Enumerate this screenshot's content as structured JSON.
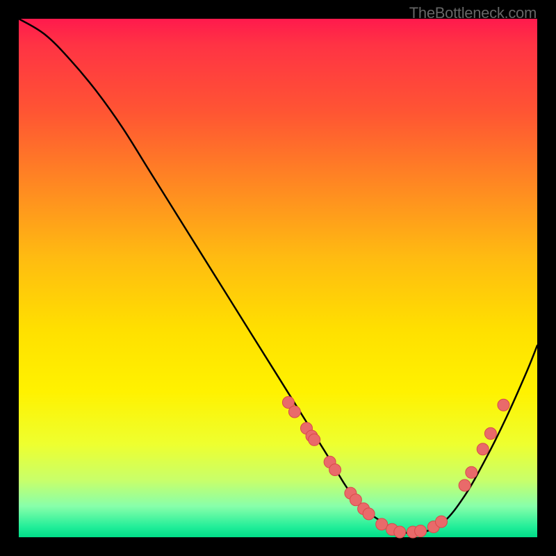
{
  "watermark": "TheBottleneck.com",
  "chart_data": {
    "type": "line",
    "title": "",
    "xlabel": "",
    "ylabel": "",
    "xlim": [
      0,
      100
    ],
    "ylim": [
      0,
      100
    ],
    "curve": {
      "x": [
        0,
        5,
        10,
        15,
        20,
        25,
        30,
        35,
        40,
        45,
        50,
        55,
        60,
        63,
        66,
        70,
        74,
        78,
        82,
        86,
        90,
        94,
        98,
        100
      ],
      "y": [
        100,
        97,
        92,
        86,
        79,
        71,
        63,
        55,
        47,
        39,
        31,
        23,
        15,
        10,
        6,
        3,
        1,
        1,
        3,
        8,
        15,
        23,
        32,
        37
      ]
    },
    "markers": [
      {
        "x": 52.0,
        "y": 26.0
      },
      {
        "x": 53.2,
        "y": 24.2
      },
      {
        "x": 55.5,
        "y": 21.0
      },
      {
        "x": 56.5,
        "y": 19.5
      },
      {
        "x": 57.0,
        "y": 18.8
      },
      {
        "x": 60.0,
        "y": 14.5
      },
      {
        "x": 61.0,
        "y": 13.0
      },
      {
        "x": 64.0,
        "y": 8.5
      },
      {
        "x": 65.0,
        "y": 7.2
      },
      {
        "x": 66.5,
        "y": 5.5
      },
      {
        "x": 67.5,
        "y": 4.5
      },
      {
        "x": 70.0,
        "y": 2.5
      },
      {
        "x": 72.0,
        "y": 1.5
      },
      {
        "x": 73.5,
        "y": 1.0
      },
      {
        "x": 76.0,
        "y": 1.0
      },
      {
        "x": 77.5,
        "y": 1.2
      },
      {
        "x": 80.0,
        "y": 2.0
      },
      {
        "x": 81.5,
        "y": 3.0
      },
      {
        "x": 86.0,
        "y": 10.0
      },
      {
        "x": 87.3,
        "y": 12.5
      },
      {
        "x": 89.5,
        "y": 17.0
      },
      {
        "x": 91.0,
        "y": 20.0
      },
      {
        "x": 93.5,
        "y": 25.5
      }
    ],
    "marker_color": "#e96a6a",
    "marker_stroke": "#d84a4a",
    "curve_color": "#000000"
  }
}
